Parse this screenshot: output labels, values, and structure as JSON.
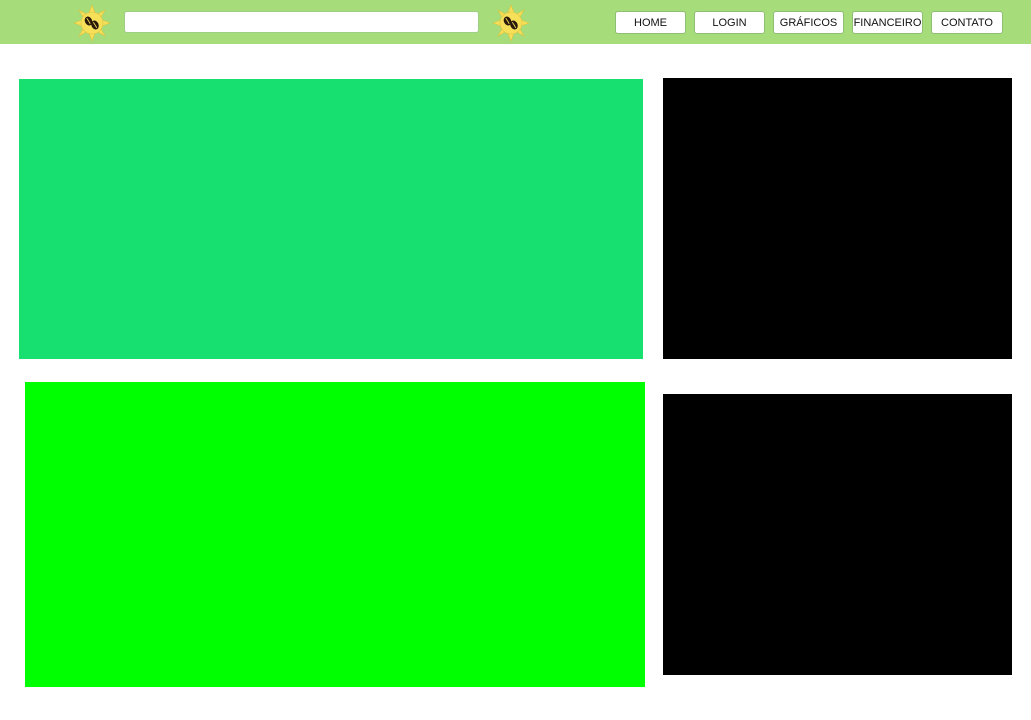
{
  "header": {
    "logo_icon": "coffee-bean-sun-icon",
    "search": {
      "value": "",
      "placeholder": ""
    },
    "nav": [
      {
        "label": "HOME"
      },
      {
        "label": "LOGIN"
      },
      {
        "label": "GRÁFICOS"
      },
      {
        "label": "FINANCEIRO"
      },
      {
        "label": "CONTATO"
      }
    ]
  },
  "colors": {
    "topbar": "#a6dc7a",
    "panel_1": "#17df70",
    "panel_2": "#000000",
    "panel_3": "#00ff00",
    "panel_4": "#000000",
    "logo_sun": "#f6e05a",
    "logo_bean": "#2a1a0c"
  }
}
